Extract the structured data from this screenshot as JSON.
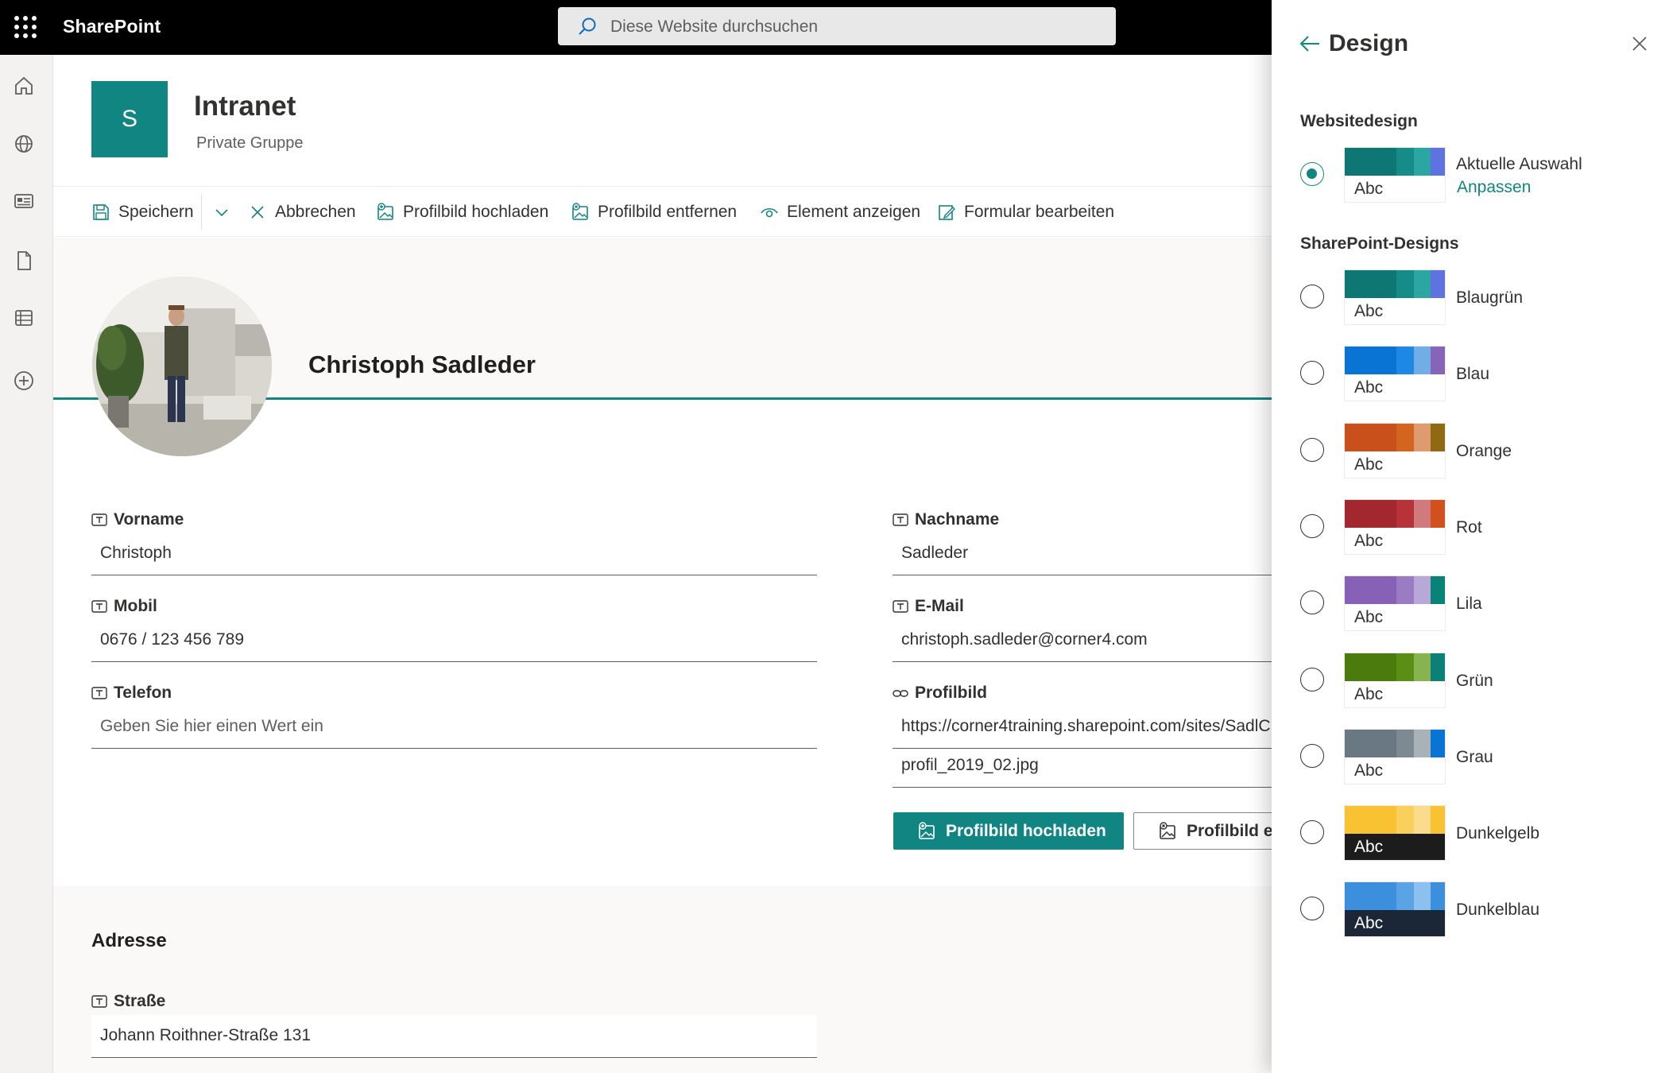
{
  "app": {
    "name": "SharePoint"
  },
  "search": {
    "placeholder": "Diese Website durchsuchen"
  },
  "site": {
    "logo_letter": "S",
    "title": "Intranet",
    "subtitle": "Private Gruppe"
  },
  "commands": {
    "save": "Speichern",
    "cancel": "Abbrechen",
    "upload": "Profilbild hochladen",
    "remove": "Profilbild entfernen",
    "view": "Element anzeigen",
    "edit_form": "Formular bearbeiten"
  },
  "profile": {
    "name": "Christoph Sadleder"
  },
  "fields": {
    "vorname": {
      "label": "Vorname",
      "value": "Christoph"
    },
    "nachname": {
      "label": "Nachname",
      "value": "Sadleder"
    },
    "mobil": {
      "label": "Mobil",
      "value": "0676 / 123 456 789"
    },
    "email": {
      "label": "E-Mail",
      "value": "christoph.sadleder@corner4.com"
    },
    "telefon": {
      "label": "Telefon",
      "placeholder": "Geben Sie hier einen Wert ein"
    },
    "profilbild": {
      "label": "Profilbild",
      "url": "https://corner4training.sharepoint.com/sites/SadlC",
      "filename": "profil_2019_02.jpg"
    }
  },
  "buttons": {
    "upload": "Profilbild hochladen",
    "remove": "Profilbild en"
  },
  "address": {
    "heading": "Adresse",
    "street_label": "Straße",
    "street_value": "Johann Roithner-Straße 131"
  },
  "panel": {
    "title": "Design",
    "section_site": "Websitedesign",
    "current_label": "Aktuelle Auswahl",
    "customize_link": "Anpassen",
    "section_sp": "SharePoint-Designs",
    "swatch_text": "Abc",
    "current": {
      "colors": [
        "#0f7773",
        "#158c88",
        "#2ba6a2",
        "#5f73e0"
      ],
      "dark": false
    },
    "themes": [
      {
        "name": "Blaugrün",
        "colors": [
          "#0f7773",
          "#158c88",
          "#2ba6a2",
          "#5f73e0"
        ],
        "dark": false
      },
      {
        "name": "Blau",
        "colors": [
          "#0a74d4",
          "#1e88e5",
          "#71aee8",
          "#8764b8"
        ],
        "dark": false
      },
      {
        "name": "Orange",
        "colors": [
          "#c9501a",
          "#d3651f",
          "#e09a70",
          "#8f6a12"
        ],
        "dark": false
      },
      {
        "name": "Rot",
        "colors": [
          "#a3272e",
          "#b83239",
          "#d07a7e",
          "#d1501b"
        ],
        "dark": false
      },
      {
        "name": "Lila",
        "colors": [
          "#8661b5",
          "#9a7cc4",
          "#b8a8d8",
          "#078377"
        ],
        "dark": false
      },
      {
        "name": "Grün",
        "colors": [
          "#4a7b0c",
          "#5a8f16",
          "#88b450",
          "#0a8077"
        ],
        "dark": false
      },
      {
        "name": "Grau",
        "colors": [
          "#697882",
          "#7d8a92",
          "#a9b2b7",
          "#0a74d4"
        ],
        "dark": false
      },
      {
        "name": "Dunkelgelb",
        "colors": [
          "#f8c233",
          "#fad05c",
          "#fbdc8c",
          "#f8c233"
        ],
        "dark": true
      },
      {
        "name": "Dunkelblau",
        "colors": [
          "#3b8fdc",
          "#5aa3e4",
          "#8cc0ee",
          "#3b8fdc"
        ],
        "dark": true
      }
    ]
  }
}
